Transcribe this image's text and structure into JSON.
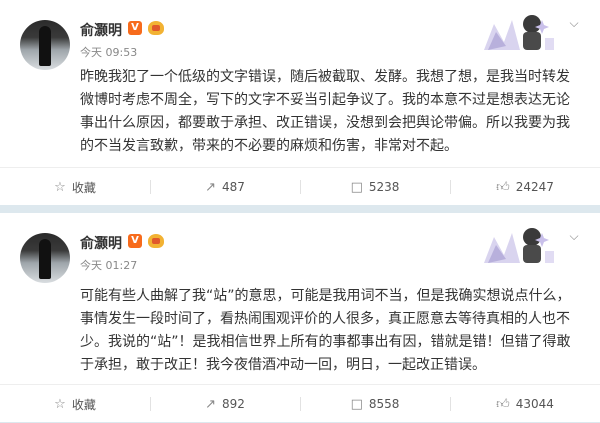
{
  "posts": [
    {
      "author": "俞灏明",
      "verified_label": "V",
      "time": "今天 09:53",
      "text": "昨晚我犯了一个低级的文字错误，随后被截取、发酵。我想了想，是我当时转发微博时考虑不周全，写下的文字不妥当引起争议了。我的本意不过是想表达无论事出什么原因，都要敢于承担、改正错误，没想到会把舆论带偏。所以我要为我的不当发言致歉，带来的不必要的麻烦和伤害，非常对不起。",
      "actions": {
        "favorite": "收藏",
        "repost": "487",
        "comment": "5238",
        "like": "24247"
      }
    },
    {
      "author": "俞灏明",
      "verified_label": "V",
      "time": "今天 01:27",
      "text": "可能有些人曲解了我“站”的意思，可能是我用词不当，但是我确实想说点什么，事情发生一段时间了，看热闹围观评价的人很多，真正愿意去等待真相的人也不少。我说的“站”！是我相信世界上所有的事都事出有因，错就是错！但错了得敢于承担，敢于改正！我今夜借酒冲动一回，明日，一起改正错误。",
      "actions": {
        "favorite": "收藏",
        "repost": "892",
        "comment": "8558",
        "like": "43044"
      }
    }
  ],
  "icons": {
    "favorite": "star-outline-icon",
    "repost": "repost-icon",
    "comment": "comment-icon",
    "like": "thumbs-up-icon",
    "more": "chevron-down-icon"
  },
  "colors": {
    "background": "#dde8ee",
    "card": "#ffffff",
    "text": "#333333",
    "meta": "#888888",
    "verified": "#f76b1c"
  }
}
